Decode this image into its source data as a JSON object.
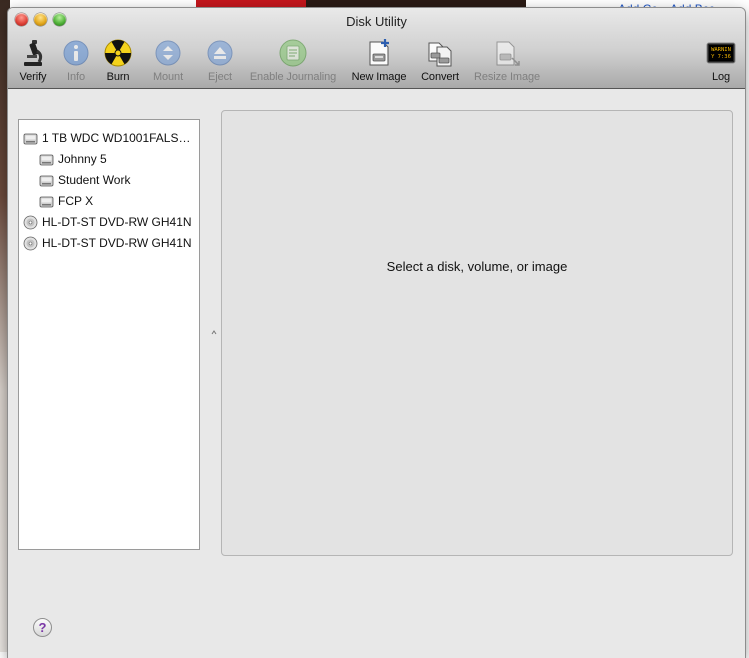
{
  "background": {
    "links": [
      "Add Cc",
      "Add Bcc"
    ]
  },
  "window": {
    "title": "Disk Utility"
  },
  "toolbar": {
    "items": [
      {
        "label": "Verify",
        "icon": "microscope-icon",
        "enabled": true
      },
      {
        "label": "Info",
        "icon": "info-icon",
        "enabled": false
      },
      {
        "label": "Burn",
        "icon": "burn-icon",
        "enabled": true
      },
      {
        "label": "Mount",
        "icon": "mount-icon",
        "enabled": false
      },
      {
        "label": "Eject",
        "icon": "eject-icon",
        "enabled": false
      },
      {
        "label": "Enable Journaling",
        "icon": "journaling-icon",
        "enabled": false
      },
      {
        "label": "New Image",
        "icon": "new-image-icon",
        "enabled": true
      },
      {
        "label": "Convert",
        "icon": "convert-icon",
        "enabled": true
      },
      {
        "label": "Resize Image",
        "icon": "resize-image-icon",
        "enabled": false
      },
      {
        "label": "Log",
        "icon": "log-console-icon",
        "enabled": true
      }
    ],
    "log_display": [
      "WARNIN",
      "Y 7:36 "
    ]
  },
  "sidebar": {
    "items": [
      {
        "label": "1 TB WDC WD1001FALS…",
        "kind": "disk",
        "level": 0
      },
      {
        "label": "Johnny 5",
        "kind": "volume",
        "level": 1
      },
      {
        "label": "Student Work",
        "kind": "volume",
        "level": 1
      },
      {
        "label": "FCP X",
        "kind": "volume",
        "level": 1
      },
      {
        "label": "HL-DT-ST DVD-RW GH41N",
        "kind": "optical",
        "level": 0
      },
      {
        "label": "HL-DT-ST DVD-RW GH41N",
        "kind": "optical",
        "level": 0
      }
    ]
  },
  "detail": {
    "message": "Select a disk, volume, or image"
  },
  "help": {
    "label": "?"
  },
  "colors": {
    "link": "#1f55c4",
    "help_glyph": "#7a36a6",
    "close": "#e0443a",
    "minimize": "#e4a91e",
    "zoom": "#52b33a"
  }
}
